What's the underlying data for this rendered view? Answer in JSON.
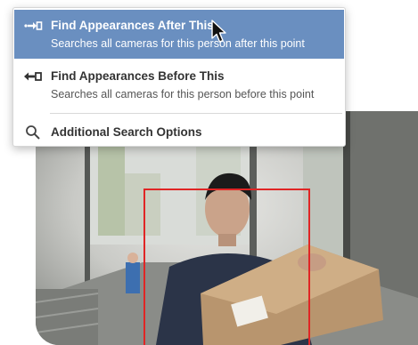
{
  "menu": {
    "items": [
      {
        "title": "Find Appearances After This",
        "subtitle": "Searches all cameras for this person after this point",
        "icon": "arrow-right-to-box-icon"
      },
      {
        "title": "Find Appearances Before This",
        "subtitle": "Searches all cameras for this person before this point",
        "icon": "arrow-left-from-box-icon"
      },
      {
        "title": "Additional Search Options",
        "icon": "search-icon"
      }
    ]
  },
  "colors": {
    "highlight": "#6a8fc0",
    "detection_box": "#e02525"
  }
}
